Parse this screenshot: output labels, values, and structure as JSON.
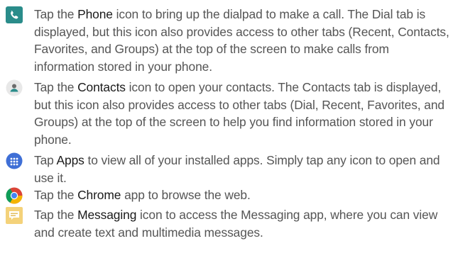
{
  "items": [
    {
      "icon": "phone-icon",
      "lead": "Tap the ",
      "keyword": "Phone",
      "rest": " icon to bring up the dialpad to make a call. The Dial tab is displayed, but this icon also provides access to other tabs (Recent, Contacts, Favorites, and Groups) at the top of the screen to make calls from information stored in your phone."
    },
    {
      "icon": "contacts-icon",
      "lead": "Tap the ",
      "keyword": "Contacts",
      "rest": " icon to open your contacts. The Contacts tab is displayed, but this icon also provides access to other tabs (Dial, Recent, Favorites, and Groups) at the top of the screen to help you find information stored in your phone."
    },
    {
      "icon": "apps-icon",
      "lead": "Tap ",
      "keyword": "Apps",
      "rest": " to view all of your installed apps. Simply tap any icon to open and use it."
    },
    {
      "icon": "chrome-icon",
      "lead": "Tap the ",
      "keyword": "Chrome",
      "rest": " app to browse the web."
    },
    {
      "icon": "messaging-icon",
      "lead": "Tap the ",
      "keyword": "Messaging",
      "rest": " icon to access the Messaging app, where you can view and create text and multimedia messages."
    }
  ],
  "colors": {
    "text": "#555555",
    "keyword": "#1a1a1a",
    "phone": "#2a8c8a",
    "contacts_bg": "#e8e8e8",
    "apps": "#3f6fd6",
    "messaging": "#f4d27a"
  }
}
